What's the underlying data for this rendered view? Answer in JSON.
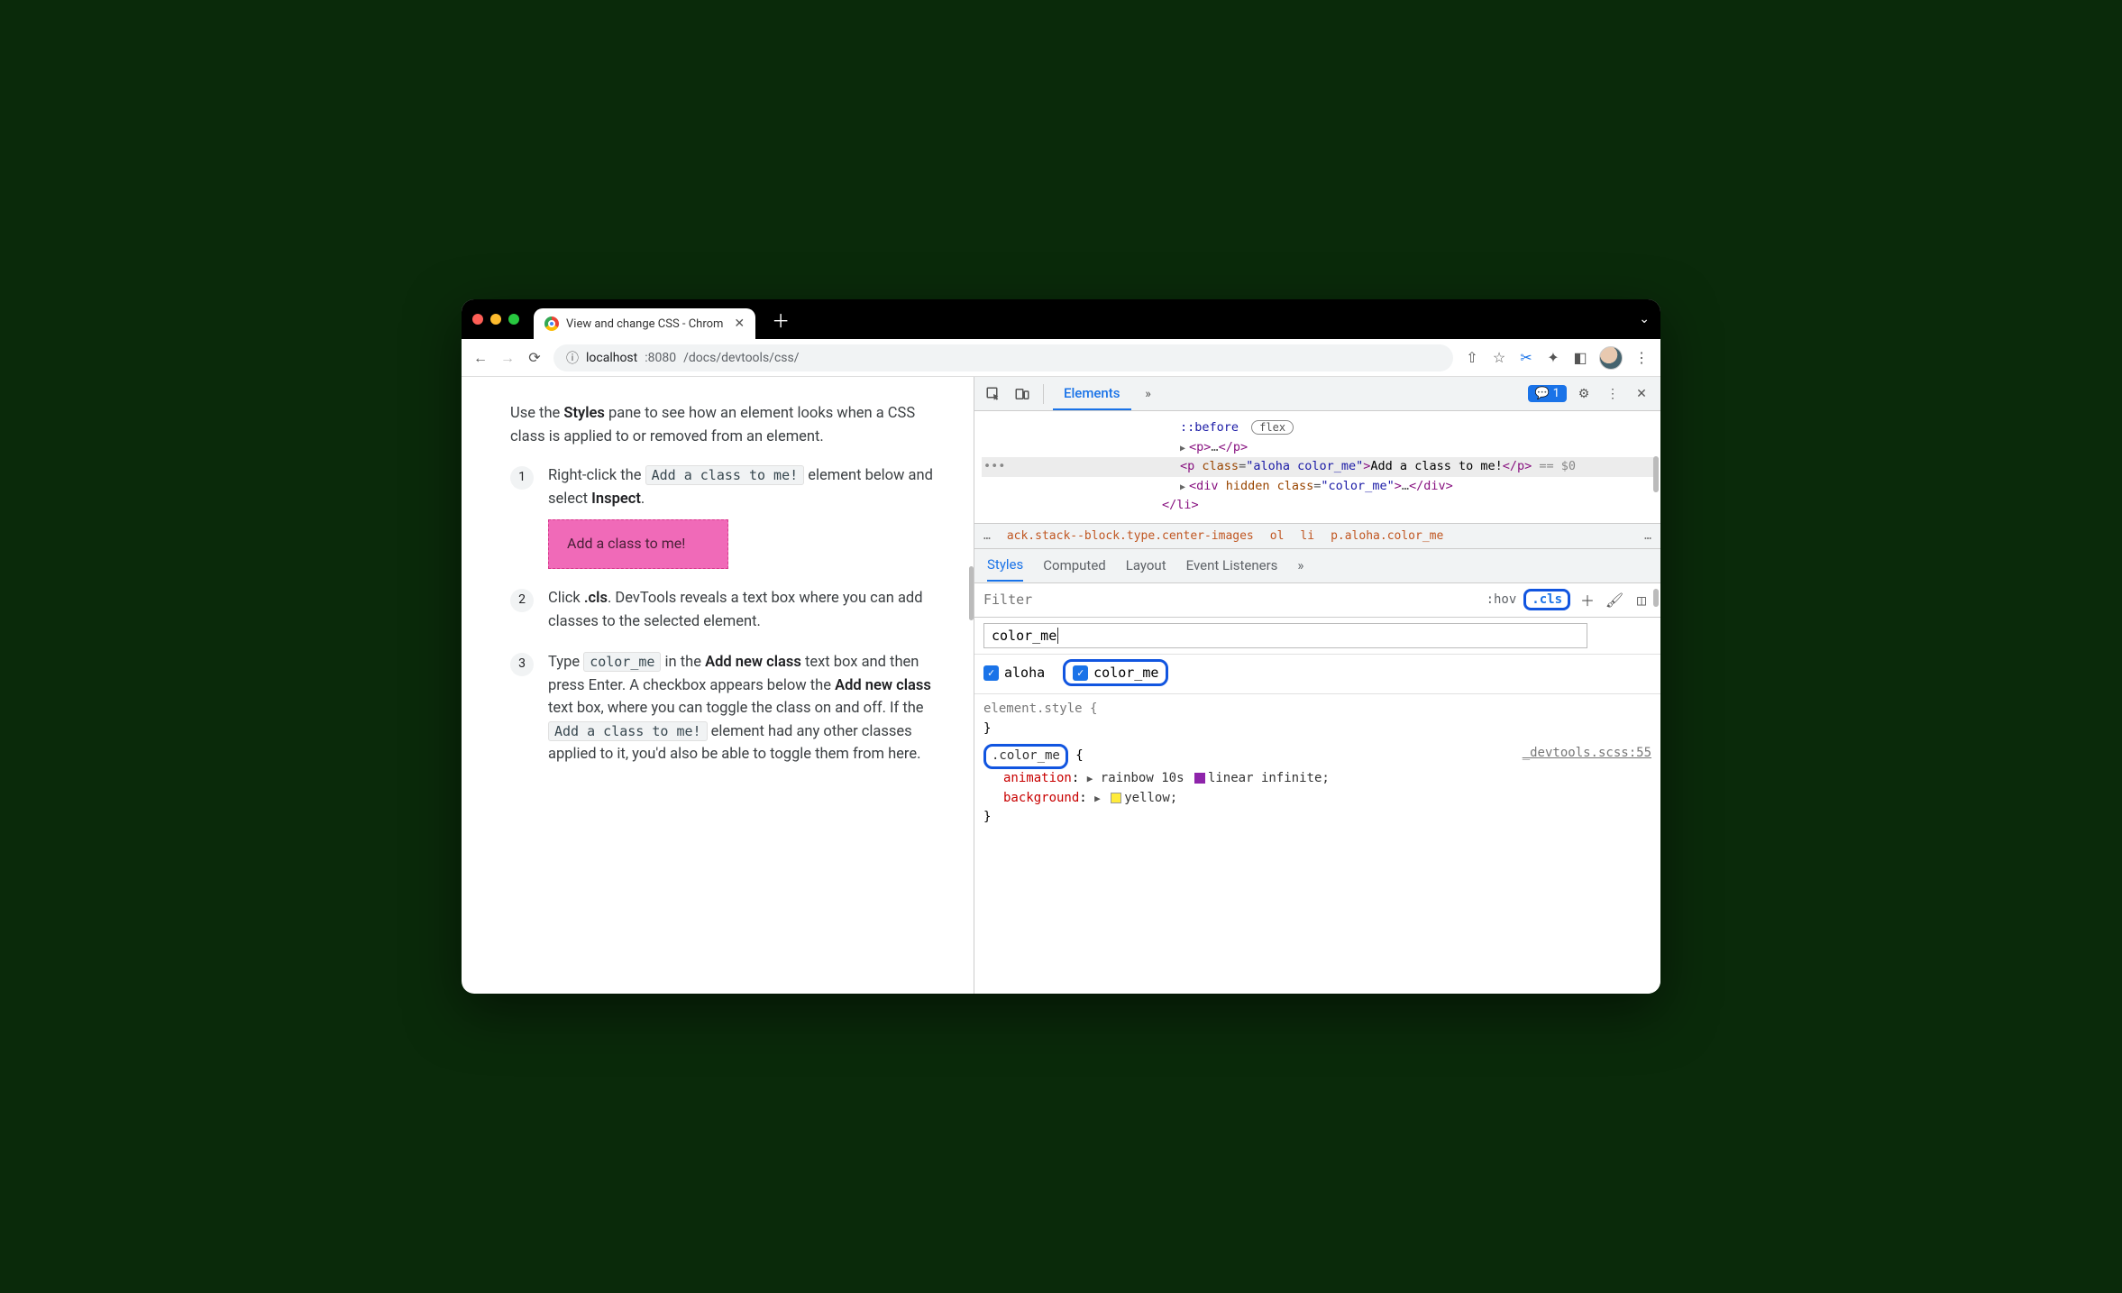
{
  "tab": {
    "title": "View and change CSS - Chrom"
  },
  "toolbar": {
    "url_host": "localhost",
    "url_port": ":8080",
    "url_path": "/docs/devtools/css/"
  },
  "page": {
    "intro_1": "Use the ",
    "intro_b": "Styles",
    "intro_2": " pane to see how an element looks when a CSS class is applied to or removed from an element.",
    "steps": [
      {
        "n": "1",
        "t1": "Right-click the ",
        "code": "Add a class to me!",
        "t2": " element below and select ",
        "b": "Inspect",
        "t3": ".",
        "demo": "Add a class to me!"
      },
      {
        "n": "2",
        "t1": "Click ",
        "b": ".cls",
        "t2": ". DevTools reveals a text box where you can add classes to the selected element."
      },
      {
        "n": "3",
        "t1": "Type ",
        "code": "color_me",
        "t2": " in the ",
        "b1": "Add new class",
        "t3": " text box and then press Enter. A checkbox appears below the ",
        "b2": "Add new class",
        "t4": " text box, where you can toggle the class on and off. If the ",
        "code2": "Add a class to me!",
        "t5": " element had any other classes applied to it, you'd also be able to toggle them from here."
      }
    ]
  },
  "devtools": {
    "tabs": {
      "elements": "Elements"
    },
    "issues_count": "1",
    "dom": {
      "before": "::before",
      "flex": "flex",
      "p_collapsed": "<p>…</p>",
      "sel_open_tag": "p",
      "sel_attr_class": "class",
      "sel_attr_val": "aloha color_me",
      "sel_text": "Add a class to me!",
      "sel_eq": " == $0",
      "div_open": "div",
      "div_hidden": "hidden",
      "div_class": "class",
      "div_class_val": "color_me",
      "div_ell": "…",
      "li_close": "</li>"
    },
    "breadcrumb": {
      "dots": "…",
      "c1": "ack.stack--block.type.center-images",
      "c2": "ol",
      "c3": "li",
      "c4": "p.aloha.color_me",
      "more": "…"
    },
    "styles_tabs": [
      "Styles",
      "Computed",
      "Layout",
      "Event Listeners"
    ],
    "filter_placeholder": "Filter",
    "hov": ":hov",
    "cls": ".cls",
    "cls_input": "color_me",
    "checks": [
      {
        "label": "aloha",
        "checked": true,
        "hl": false
      },
      {
        "label": "color_me",
        "checked": true,
        "hl": true
      }
    ],
    "rules": {
      "el_style": "element.style {",
      "brace_close": "}",
      "color_me_sel": ".color_me",
      "color_me_src": "_devtools.scss:55",
      "anim_prop": "animation",
      "anim_val": "rainbow 10s ",
      "anim_val2": "linear infinite;",
      "bg_prop": "background",
      "bg_val": "yellow;"
    }
  }
}
